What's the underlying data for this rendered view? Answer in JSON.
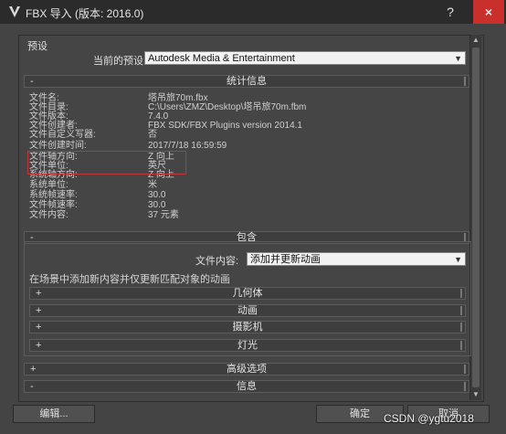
{
  "window": {
    "title": "FBX 导入 (版本: 2016.0)",
    "help_label": "?",
    "close_label": "×"
  },
  "presets": {
    "section_label": "预设",
    "current_label": "当前的预设:",
    "current_value": "Autodesk Media & Entertainment"
  },
  "stats_panel": {
    "sign": "-",
    "title": "统计信息",
    "rows": [
      {
        "label": "文件名:",
        "value": "塔吊旅70m.fbx"
      },
      {
        "label": "文件目录:",
        "value": "C:\\Users\\ZMZ\\Desktop\\塔吊旅70m.fbm"
      },
      {
        "label": "文件版本:",
        "value": "7.4.0"
      },
      {
        "label": "文件创建者:",
        "value": "FBX SDK/FBX Plugins version 2014.1"
      },
      {
        "label": "文件自定义写器:",
        "value": "否"
      },
      {
        "label": "文件创建时间:",
        "value": "2017/7/18  16:59:59"
      },
      {
        "label": "文件轴方向:",
        "value": "Z 向上"
      },
      {
        "label": "文件单位:",
        "value": "英尺"
      },
      {
        "label": "系统轴方向:",
        "value": "Z 向上"
      },
      {
        "label": "系统单位:",
        "value": "米"
      },
      {
        "label": "系统帧速率:",
        "value": "30.0"
      },
      {
        "label": "文件帧速率:",
        "value": "30.0"
      },
      {
        "label": "文件内容:",
        "value": "37 元素"
      }
    ]
  },
  "include_panel": {
    "sign": "-",
    "title": "包含",
    "content_label": "文件内容:",
    "content_value": "添加并更新动画",
    "info": "在场景中添加新内容并仅更新匹配对象的动画",
    "subsections": [
      {
        "sign": "+",
        "label": "几何体"
      },
      {
        "sign": "+",
        "label": "动画"
      },
      {
        "sign": "+",
        "label": "摄影机"
      },
      {
        "sign": "+",
        "label": "灯光"
      }
    ]
  },
  "advanced_panel": {
    "sign": "+",
    "title": "高级选项"
  },
  "info_panel": {
    "sign": "-",
    "title": "信息"
  },
  "buttons": {
    "edit": "编辑...",
    "ok": "确定",
    "cancel": "取消"
  },
  "watermark": "CSDN @ygtu2018",
  "colors": {
    "title_bar": "#2b2b2b",
    "panel_bg": "#454545",
    "close_button": "#c9302c",
    "highlight_box": "#c2363a"
  }
}
